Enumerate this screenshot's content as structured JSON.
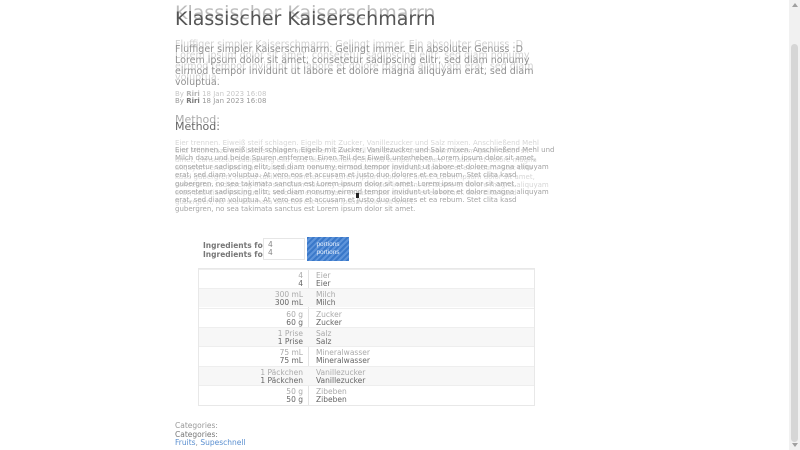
{
  "recipe": {
    "title": "Klassischer Kaiserschmarrn",
    "intro": "Fluffiger simpler Kaiserschmarrn. Gelingt immer. Ein absoluter Genuss :D Lorem ipsum dolor sit amet, consetetur sadipscing elitr, sed diam nonumy eirmod tempor invidunt ut labore et dolore magna aliquyam erat, sed diam voluptua.",
    "author_prefix": "By",
    "author": "Riri",
    "date": "18 Jan 2023 16:08",
    "method_heading": "Method:",
    "method_text": "Eier trennen. Eiweiß steif schlagen. Eigelb mit Zucker, Vanillezucker und Salz mixen. Anschließend Mehl und Milch dazu und beide Spuren entfernen. Einen Teil des Eiweiß unterheben. Lorem ipsum dolor sit amet, consetetur sadipscing elitr, sed diam nonumy eirmod tempor invidunt ut labore et dolore magna aliquyam erat, sed diam voluptua. At vero eos et accusam et justo duo dolores et ea rebum. Stet clita kasd gubergren, no sea takimata sanctus est Lorem ipsum dolor sit amet. Lorem ipsum dolor sit amet, consetetur sadipscing elitr, sed diam nonumy eirmod tempor invidunt ut labore et dolore magna aliquyam erat, sed diam voluptua. At vero eos et accusam et justo duo dolores et ea rebum. Stet clita kasd gubergren, no sea takimata sanctus est Lorem ipsum dolor sit amet."
  },
  "servings": {
    "label": "Ingredients for",
    "value": "4",
    "button_label": "portions"
  },
  "ingredients": [
    {
      "amount": "4",
      "name": "Eier"
    },
    {
      "amount": "300 mL",
      "name": "Milch"
    },
    {
      "amount": "60 g",
      "name": "Zucker"
    },
    {
      "amount": "1 Prise",
      "name": "Salz"
    },
    {
      "amount": "75 mL",
      "name": "Mineralwasser"
    },
    {
      "amount": "1 Päckchen",
      "name": "Vanillezucker"
    },
    {
      "amount": "50 g",
      "name": "Zibeben"
    }
  ],
  "categories": {
    "label": "Categories:",
    "items": [
      "Fruits",
      "Supeschnell"
    ]
  }
}
